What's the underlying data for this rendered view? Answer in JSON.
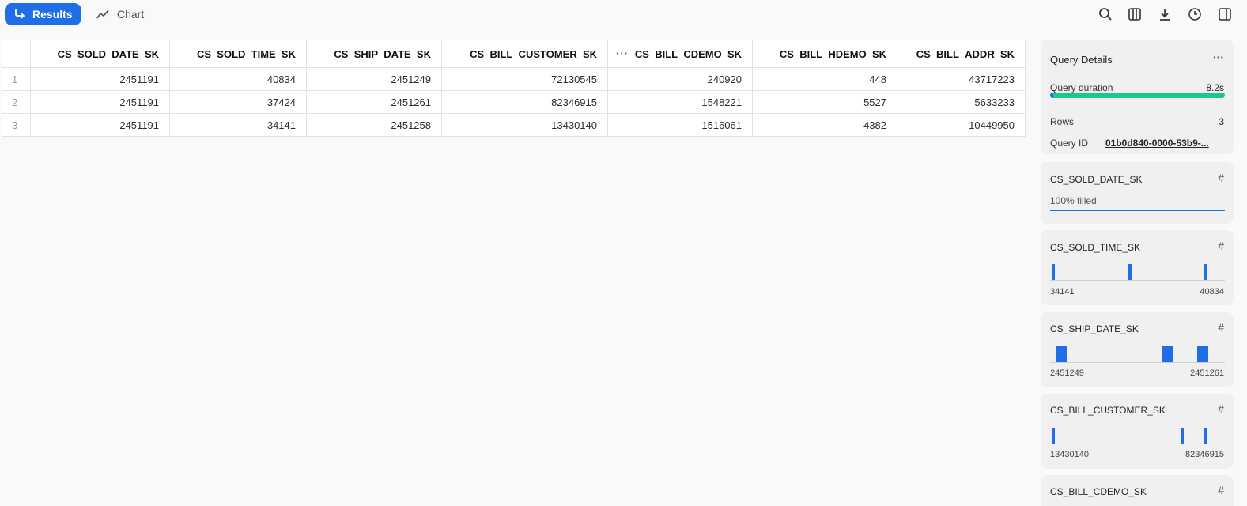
{
  "toolbar": {
    "results_label": "Results",
    "chart_label": "Chart",
    "icons": [
      "search-icon",
      "columns-icon",
      "download-icon",
      "history-icon",
      "panel-toggle-icon"
    ]
  },
  "table": {
    "columns": [
      "CS_SOLD_DATE_SK",
      "CS_SOLD_TIME_SK",
      "CS_SHIP_DATE_SK",
      "CS_BILL_CUSTOMER_SK",
      "CS_BILL_CDEMO_SK",
      "CS_BILL_HDEMO_SK",
      "CS_BILL_ADDR_SK"
    ],
    "more_indicator": "···",
    "rows": [
      {
        "idx": "1",
        "cells": [
          "2451191",
          "40834",
          "2451249",
          "72130545",
          "240920",
          "448",
          "43717223"
        ]
      },
      {
        "idx": "2",
        "cells": [
          "2451191",
          "37424",
          "2451261",
          "82346915",
          "1548221",
          "5527",
          "5633233"
        ]
      },
      {
        "idx": "3",
        "cells": [
          "2451191",
          "34141",
          "2451258",
          "13430140",
          "1516061",
          "4382",
          "10449950"
        ]
      }
    ]
  },
  "query_details": {
    "title": "Query Details",
    "menu": "···",
    "duration_label": "Query duration",
    "duration_value": "8.2s",
    "duration_fraction": 0.02,
    "rows_label": "Rows",
    "rows_value": "3",
    "query_id_label": "Query ID",
    "query_id_value": "01b0d840-0000-53b9-..."
  },
  "column_stats": [
    {
      "name": "CS_SOLD_DATE_SK",
      "filled": "100% filled"
    },
    {
      "name": "CS_SOLD_TIME_SK",
      "min": "34141",
      "max": "40834"
    },
    {
      "name": "CS_SHIP_DATE_SK",
      "min": "2451249",
      "max": "2451261"
    },
    {
      "name": "CS_BILL_CUSTOMER_SK",
      "min": "13430140",
      "max": "82346915"
    },
    {
      "name": "CS_BILL_CDEMO_SK"
    }
  ],
  "colors": {
    "accent": "#1f6ee8",
    "duration_bar": "#18c98e"
  }
}
